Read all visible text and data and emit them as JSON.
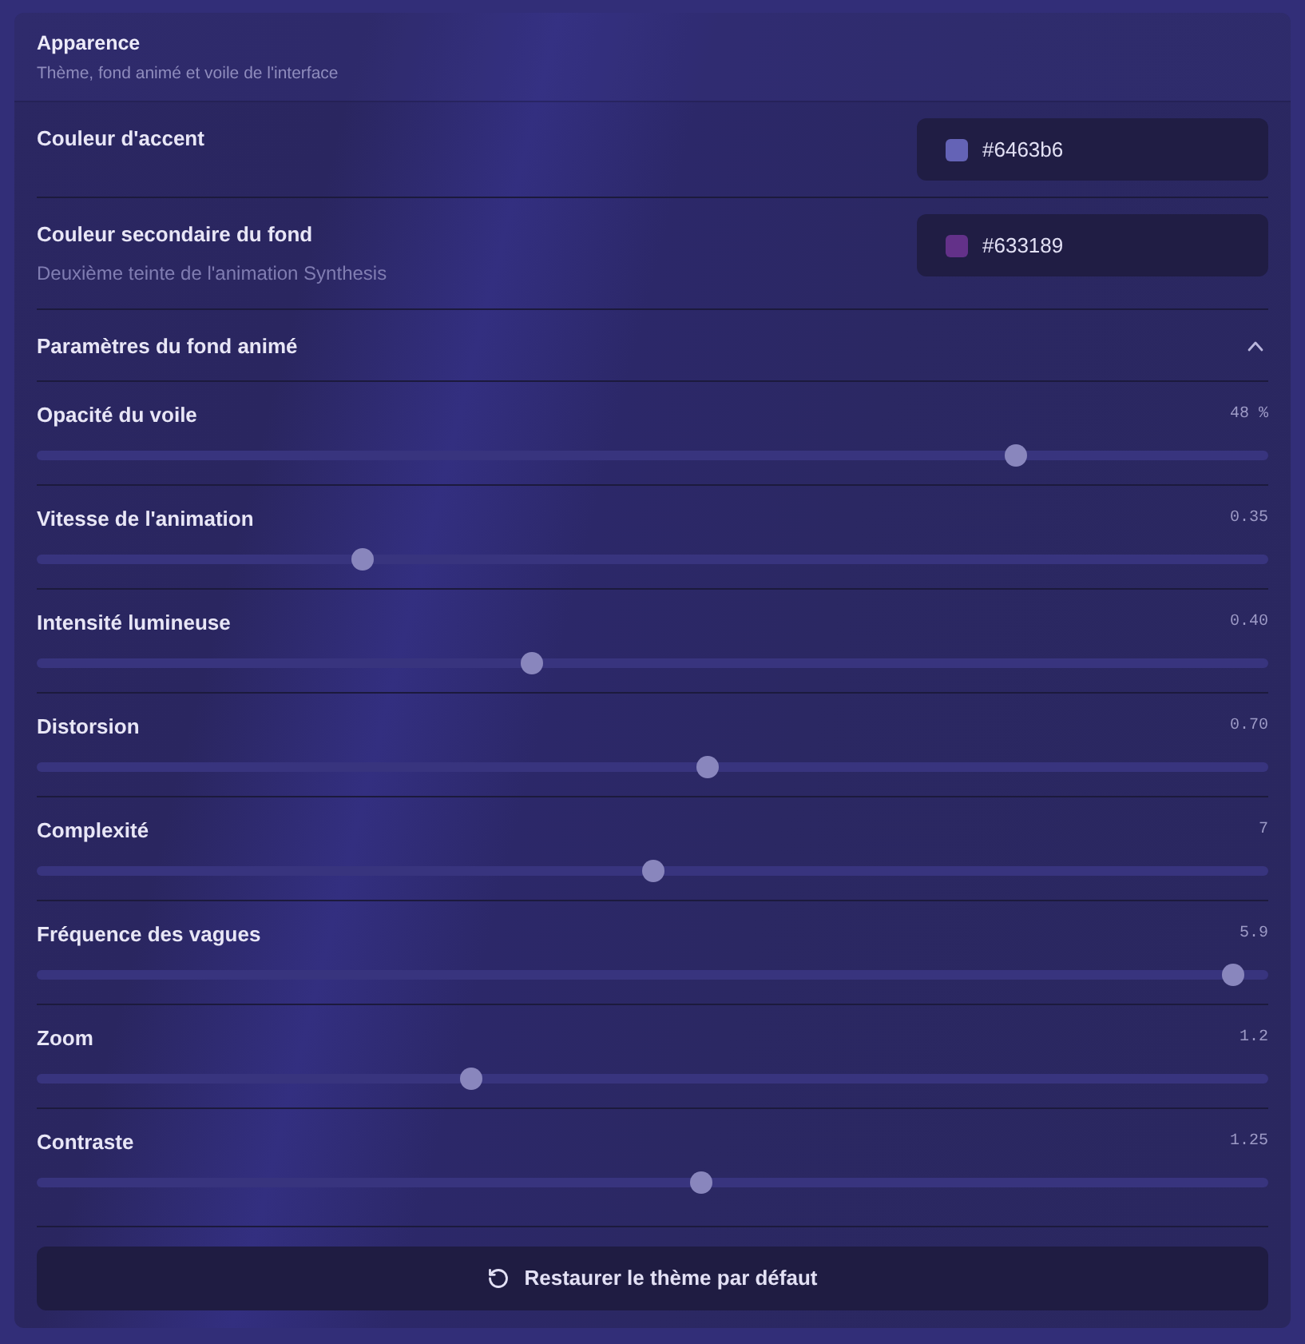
{
  "panel": {
    "title": "Apparence",
    "subtitle": "Thème, fond animé et voile de l'interface"
  },
  "color_settings": [
    {
      "label": "Couleur d'accent",
      "value": "#6463b6",
      "color": "#6463b6"
    },
    {
      "label": "Couleur secondaire du fond",
      "description": "Deuxième teinte de l'animation Synthesis",
      "value": "#633189",
      "color": "#633189"
    }
  ],
  "animated_background": {
    "title": "Paramètres du fond animé",
    "expanded": true,
    "sliders": [
      {
        "label": "Opacité du voile",
        "reading": "48 %",
        "level": 0.8
      },
      {
        "label": "Vitesse de l'animation",
        "reading": "0.35",
        "level": 0.26
      },
      {
        "label": "Intensité lumineuse",
        "reading": "0.40",
        "level": 0.4
      },
      {
        "label": "Distorsion",
        "reading": "0.70",
        "level": 0.545
      },
      {
        "label": "Complexité",
        "reading": "7",
        "level": 0.5
      },
      {
        "label": "Fréquence des vagues",
        "reading": "5.9",
        "level": 0.98
      },
      {
        "label": "Zoom",
        "reading": "1.2",
        "level": 0.35
      },
      {
        "label": "Contraste",
        "reading": "1.25",
        "level": 0.54
      }
    ]
  },
  "reset_button": {
    "label": "Restaurer le thème par défaut"
  }
}
